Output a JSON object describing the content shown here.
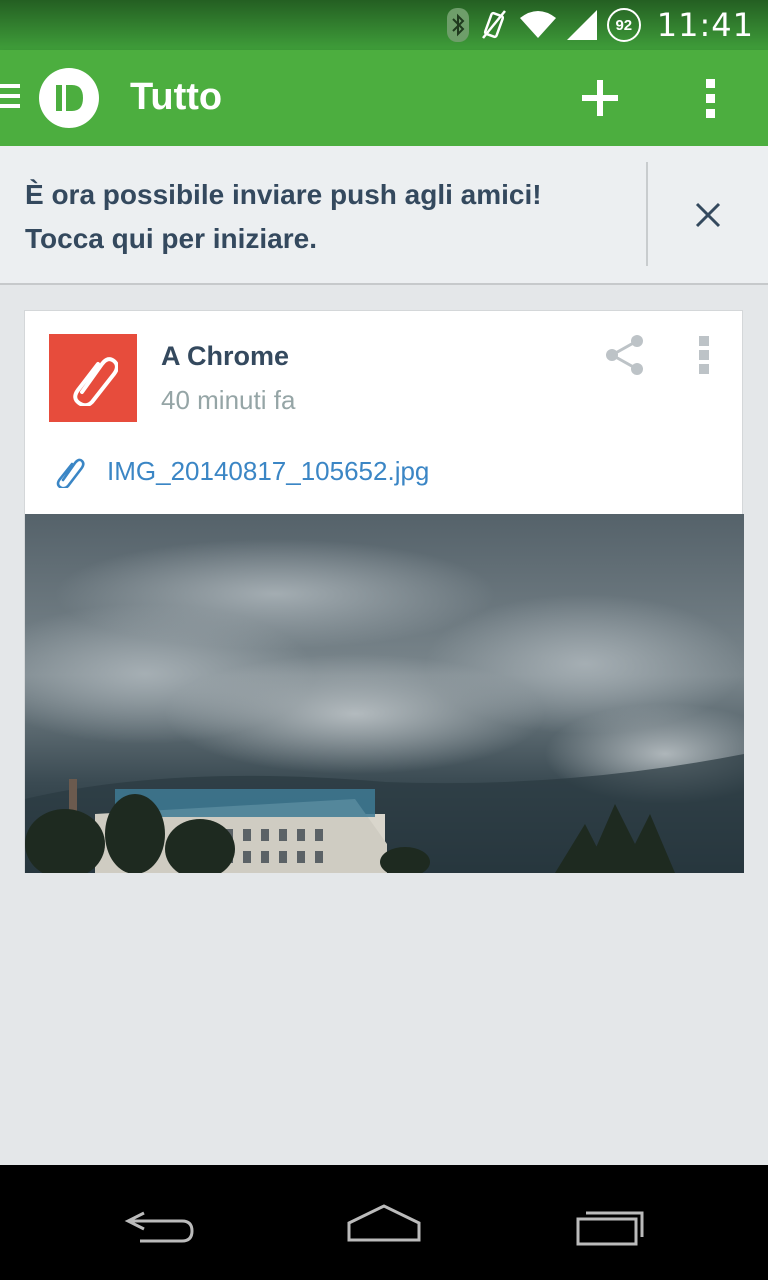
{
  "status_bar": {
    "time": "11:41",
    "battery_level": "92",
    "icons": [
      "bluetooth-icon",
      "vibrate-off-icon",
      "wifi-icon",
      "signal-icon",
      "battery-icon"
    ]
  },
  "app_bar": {
    "title": "Tutto",
    "icons": [
      "menu-icon",
      "pushbullet-logo",
      "add-icon",
      "overflow-icon"
    ]
  },
  "banner": {
    "line1": "È ora possibile inviare push agli amici!",
    "line2": "Tocca qui per iniziare."
  },
  "push_card": {
    "title": "A Chrome",
    "time": "40 minuti fa",
    "attachment_name": "IMG_20140817_105652.jpg",
    "badge_color": "#e74c3c"
  },
  "nav_bar": {
    "icons": [
      "back-icon",
      "home-icon",
      "recents-icon"
    ]
  },
  "colors": {
    "app_bar": "#4cae3f",
    "status_bar": "#3f9e3a",
    "accent_link": "#3b86c5",
    "text_primary": "#34495e"
  }
}
